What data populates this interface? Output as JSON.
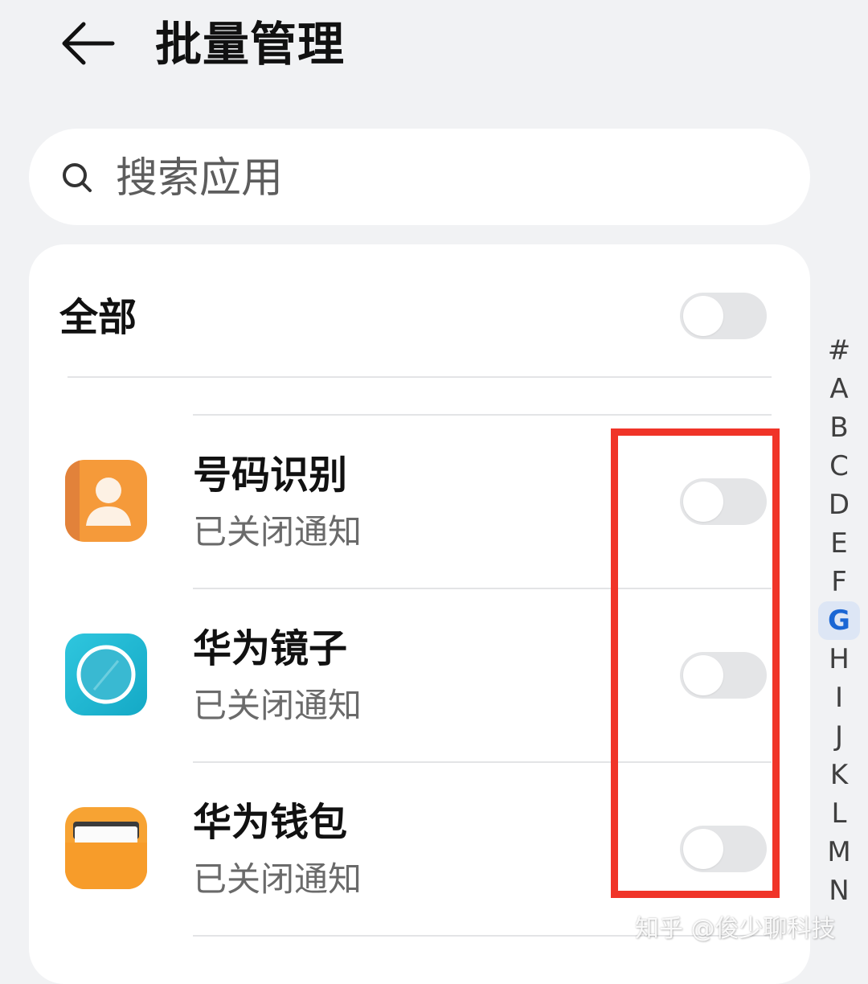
{
  "header": {
    "title": "批量管理",
    "back_icon": "arrow-left-icon"
  },
  "search": {
    "placeholder": "搜索应用",
    "icon": "search-icon"
  },
  "all_toggle": {
    "label": "全部",
    "on": false
  },
  "apps": [
    {
      "name": "号码识别",
      "status": "已关闭通知",
      "icon": "contact-person-icon",
      "notifications_on": false
    },
    {
      "name": "华为镜子",
      "status": "已关闭通知",
      "icon": "mirror-icon",
      "notifications_on": false
    },
    {
      "name": "华为钱包",
      "status": "已关闭通知",
      "icon": "wallet-icon",
      "notifications_on": false
    }
  ],
  "index_bar": {
    "letters": [
      "#",
      "A",
      "B",
      "C",
      "D",
      "E",
      "F",
      "G",
      "H",
      "I",
      "J",
      "K",
      "L",
      "M",
      "N"
    ],
    "active": "G"
  },
  "watermark": "知乎 @俊少聊科技",
  "colors": {
    "background": "#f1f2f4",
    "card": "#ffffff",
    "toggle_off": "#e4e5e7",
    "highlight": "#f03428",
    "index_active": "#1a66d4"
  }
}
